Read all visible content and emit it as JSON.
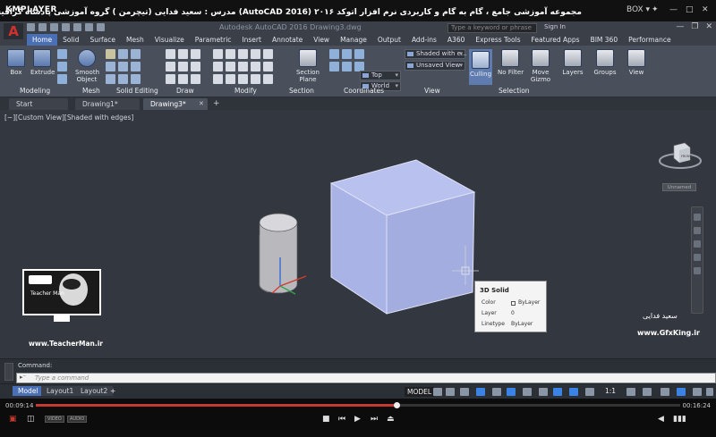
{
  "player": {
    "brand": "KMPLAYER",
    "title": "مجموعه آموزشی جامع ، گام به گام و کاربردی نرم افزار  اتوکد ۲۰۱۶  (AutoCAD 2016)   مدرس : سعید فدایی (تیچرمن ) گروه آموزشی پادشاه گرافیست ها",
    "time_current": "00:09:14",
    "time_total": "00:16:24",
    "progress_fraction": 0.56,
    "badge_left": "VIDEO",
    "badge_right": "AUDIO"
  },
  "app": {
    "logo_letter": "A",
    "window_title": "Autodesk AutoCAD 2016    Drawing3.dwg",
    "search_placeholder": "Type a keyword or phrase",
    "signin_label": "Sign In"
  },
  "ribbon_tabs": [
    "Home",
    "Solid",
    "Surface",
    "Mesh",
    "Visualize",
    "Parametric",
    "Insert",
    "Annotate",
    "View",
    "Manage",
    "Output",
    "Add-ins",
    "A360",
    "Express Tools",
    "Featured Apps",
    "BIM 360",
    "Performance"
  ],
  "ribbon": {
    "box": "Box",
    "extrude": "Extrude",
    "smooth_object_1": "Smooth",
    "smooth_object_2": "Object",
    "section_plane_1": "Section",
    "section_plane_2": "Plane",
    "culling": "Culling",
    "no_filter": "No Filter",
    "move_gizmo_1": "Move",
    "move_gizmo_2": "Gizmo",
    "layers": "Layers",
    "groups": "Groups",
    "view_btn": "View",
    "visual_style": "Shaded with e...",
    "named_view": "Unsaved View",
    "ucs": "Top",
    "ucs_world": "World",
    "panels": {
      "modeling": "Modeling",
      "mesh": "Mesh",
      "solid_editing": "Solid Editing",
      "draw": "Draw",
      "modify": "Modify",
      "section": "Section",
      "coordinates": "Coordinates",
      "view": "View",
      "selection": "Selection"
    }
  },
  "doc_tabs": [
    "Start",
    "Drawing1*",
    "Drawing3*"
  ],
  "viewport": {
    "label": "[−][Custom View][Shaded with edges]",
    "viewcube_face": "FRONT",
    "unnamed": "Unnamed"
  },
  "tooltip": {
    "title": "3D Solid",
    "rows": [
      {
        "k": "Color",
        "v": "ByLayer"
      },
      {
        "k": "Layer",
        "v": "0"
      },
      {
        "k": "Linetype",
        "v": "ByLayer"
      }
    ]
  },
  "command": {
    "label": "Command:",
    "prompt": "▸⁻",
    "placeholder": "Type a command"
  },
  "layout_tabs": [
    "Model",
    "Layout1",
    "Layout2"
  ],
  "status": {
    "model": "MODEL",
    "scale": "1:1"
  },
  "overlays": {
    "teacherman_url": "www.TeacherMan.ir",
    "teacherman_name": "Teacher Man",
    "gfx_name": "سعید فدایی",
    "gfx_url": "www.GfxKing.ir"
  },
  "colors": {
    "ribbon_active_tab": "#4a6fb5",
    "viewport_bg": "#33373f",
    "box_fill": "#a9b2e4",
    "seek_fill": "#c53a2f"
  }
}
